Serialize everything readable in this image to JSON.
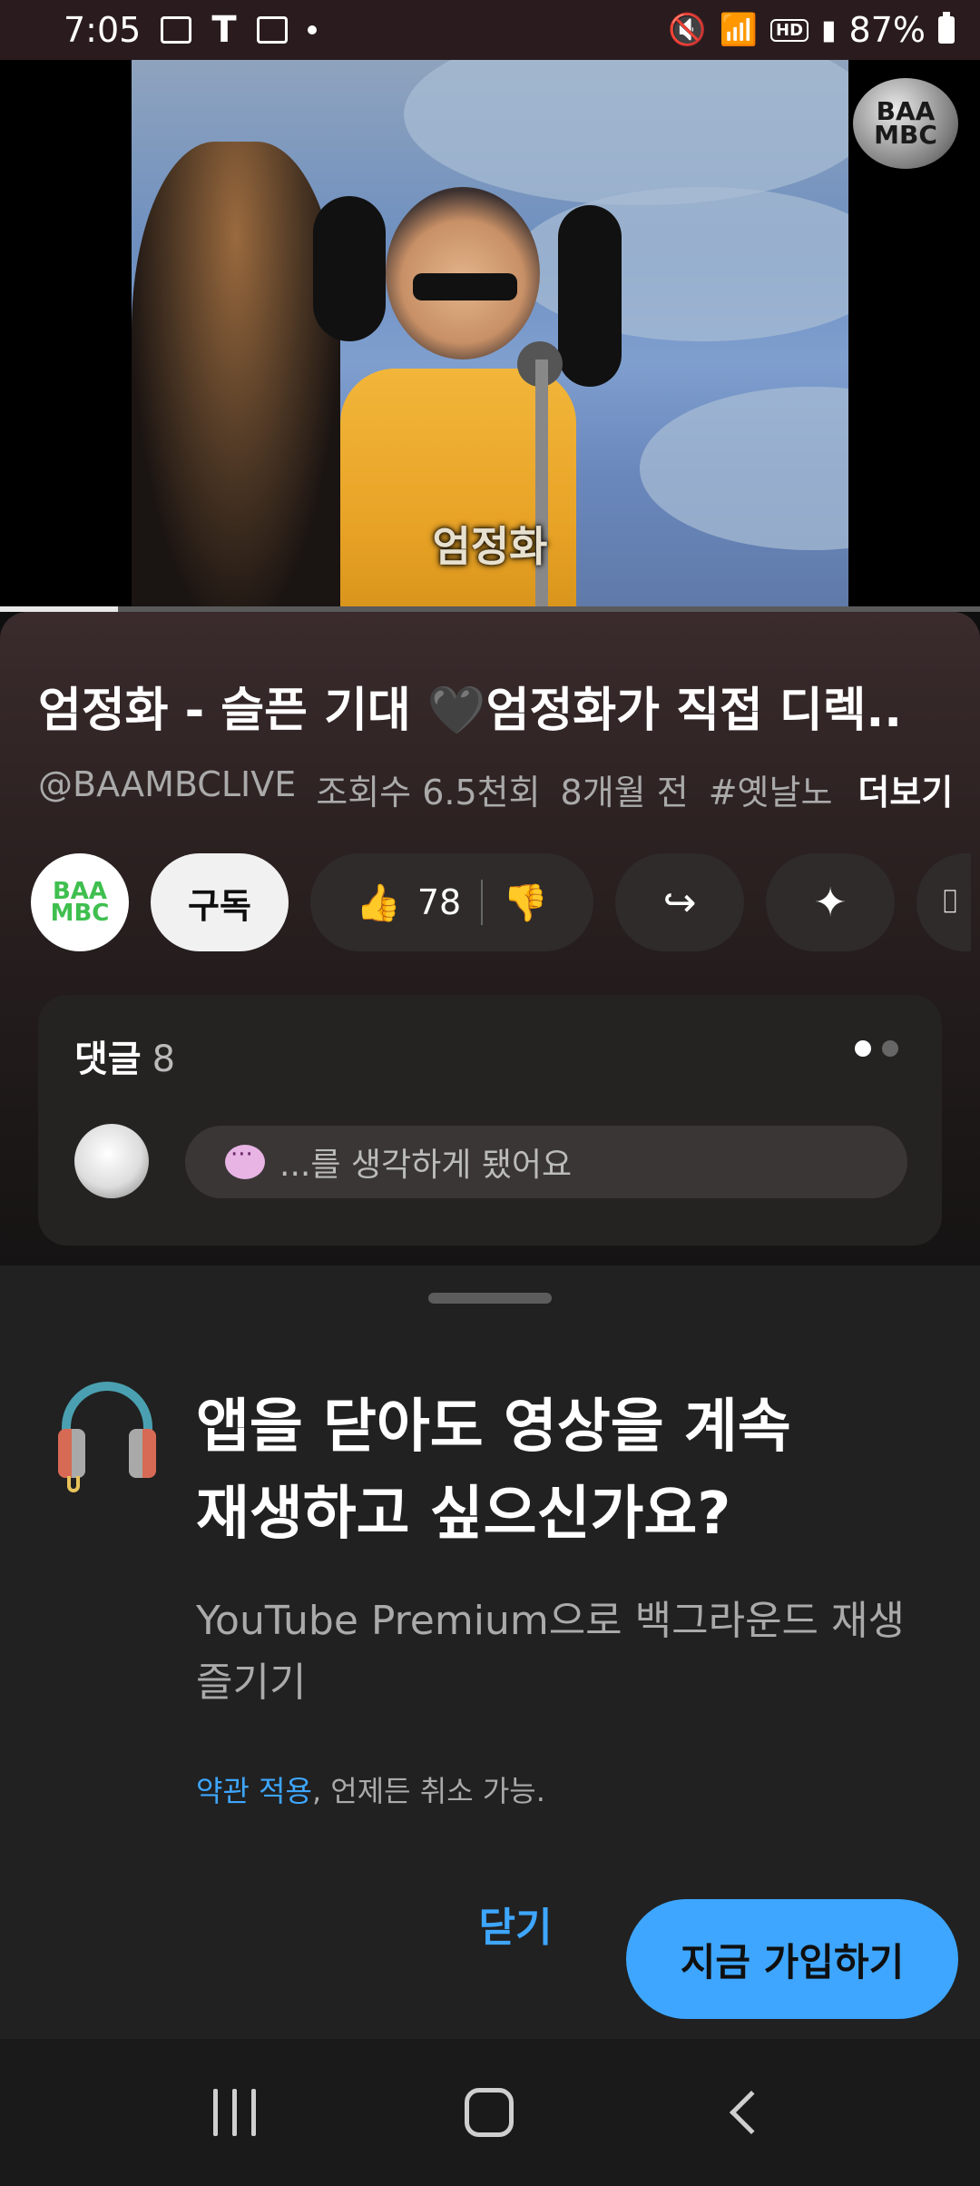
{
  "status_bar": {
    "time": "7:05",
    "battery": "87%",
    "icons": [
      "gallery-icon",
      "text-t-icon",
      "calendar-icon",
      "dot-icon",
      "mute-icon",
      "wifi-icon",
      "hd-voice-icon",
      "signal-icon",
      "battery-icon"
    ]
  },
  "video": {
    "caption": "엄정화",
    "channel_watermark": "BAA MBC",
    "progress": 0.12
  },
  "info": {
    "title": "엄정화 - 슬픈 기대 🖤엄정화가 직접 디렉..",
    "handle": "@BAAMBCLIVE",
    "views": "조회수 6.5천회",
    "age": "8개월 전",
    "hashtag": "#옛날노",
    "more": "더보기"
  },
  "actions": {
    "channel_avatar_text": "BAA MBC",
    "subscribe": "구독",
    "likes": "78"
  },
  "comments": {
    "label": "댓글",
    "count": "8",
    "preview": "...를 생각하게 됐어요"
  },
  "sheet": {
    "title_line1": "앱을 닫아도 영상을 계속",
    "title_line2": "재생하고 싶으신가요?",
    "subtitle": "YouTube Premium으로 백그라운드 재생 즐기기",
    "terms_link": "약관 적용",
    "terms_text": ", 언제든 취소 가능.",
    "close": "닫기",
    "join": "지금 가입하기"
  },
  "colors": {
    "accent": "#3ea6ff",
    "sheet_bg": "#212121",
    "status_bar_bg": "#2a1c1e"
  }
}
